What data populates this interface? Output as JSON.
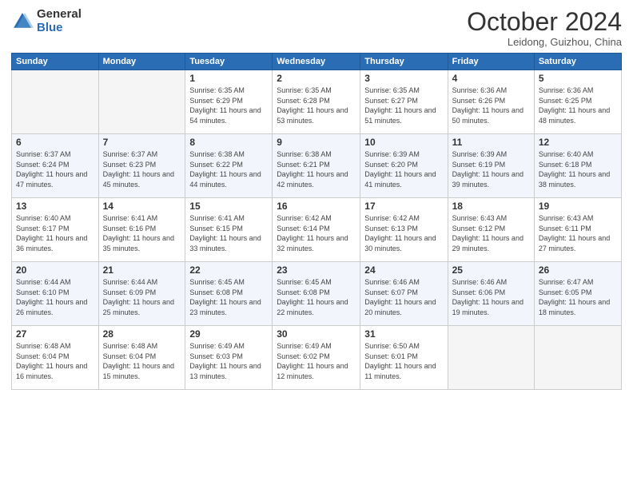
{
  "header": {
    "logo_general": "General",
    "logo_blue": "Blue",
    "month_title": "October 2024",
    "subtitle": "Leidong, Guizhou, China"
  },
  "days_of_week": [
    "Sunday",
    "Monday",
    "Tuesday",
    "Wednesday",
    "Thursday",
    "Friday",
    "Saturday"
  ],
  "weeks": [
    [
      {
        "day": "",
        "info": ""
      },
      {
        "day": "",
        "info": ""
      },
      {
        "day": "1",
        "info": "Sunrise: 6:35 AM\nSunset: 6:29 PM\nDaylight: 11 hours and 54 minutes."
      },
      {
        "day": "2",
        "info": "Sunrise: 6:35 AM\nSunset: 6:28 PM\nDaylight: 11 hours and 53 minutes."
      },
      {
        "day": "3",
        "info": "Sunrise: 6:35 AM\nSunset: 6:27 PM\nDaylight: 11 hours and 51 minutes."
      },
      {
        "day": "4",
        "info": "Sunrise: 6:36 AM\nSunset: 6:26 PM\nDaylight: 11 hours and 50 minutes."
      },
      {
        "day": "5",
        "info": "Sunrise: 6:36 AM\nSunset: 6:25 PM\nDaylight: 11 hours and 48 minutes."
      }
    ],
    [
      {
        "day": "6",
        "info": "Sunrise: 6:37 AM\nSunset: 6:24 PM\nDaylight: 11 hours and 47 minutes."
      },
      {
        "day": "7",
        "info": "Sunrise: 6:37 AM\nSunset: 6:23 PM\nDaylight: 11 hours and 45 minutes."
      },
      {
        "day": "8",
        "info": "Sunrise: 6:38 AM\nSunset: 6:22 PM\nDaylight: 11 hours and 44 minutes."
      },
      {
        "day": "9",
        "info": "Sunrise: 6:38 AM\nSunset: 6:21 PM\nDaylight: 11 hours and 42 minutes."
      },
      {
        "day": "10",
        "info": "Sunrise: 6:39 AM\nSunset: 6:20 PM\nDaylight: 11 hours and 41 minutes."
      },
      {
        "day": "11",
        "info": "Sunrise: 6:39 AM\nSunset: 6:19 PM\nDaylight: 11 hours and 39 minutes."
      },
      {
        "day": "12",
        "info": "Sunrise: 6:40 AM\nSunset: 6:18 PM\nDaylight: 11 hours and 38 minutes."
      }
    ],
    [
      {
        "day": "13",
        "info": "Sunrise: 6:40 AM\nSunset: 6:17 PM\nDaylight: 11 hours and 36 minutes."
      },
      {
        "day": "14",
        "info": "Sunrise: 6:41 AM\nSunset: 6:16 PM\nDaylight: 11 hours and 35 minutes."
      },
      {
        "day": "15",
        "info": "Sunrise: 6:41 AM\nSunset: 6:15 PM\nDaylight: 11 hours and 33 minutes."
      },
      {
        "day": "16",
        "info": "Sunrise: 6:42 AM\nSunset: 6:14 PM\nDaylight: 11 hours and 32 minutes."
      },
      {
        "day": "17",
        "info": "Sunrise: 6:42 AM\nSunset: 6:13 PM\nDaylight: 11 hours and 30 minutes."
      },
      {
        "day": "18",
        "info": "Sunrise: 6:43 AM\nSunset: 6:12 PM\nDaylight: 11 hours and 29 minutes."
      },
      {
        "day": "19",
        "info": "Sunrise: 6:43 AM\nSunset: 6:11 PM\nDaylight: 11 hours and 27 minutes."
      }
    ],
    [
      {
        "day": "20",
        "info": "Sunrise: 6:44 AM\nSunset: 6:10 PM\nDaylight: 11 hours and 26 minutes."
      },
      {
        "day": "21",
        "info": "Sunrise: 6:44 AM\nSunset: 6:09 PM\nDaylight: 11 hours and 25 minutes."
      },
      {
        "day": "22",
        "info": "Sunrise: 6:45 AM\nSunset: 6:08 PM\nDaylight: 11 hours and 23 minutes."
      },
      {
        "day": "23",
        "info": "Sunrise: 6:45 AM\nSunset: 6:08 PM\nDaylight: 11 hours and 22 minutes."
      },
      {
        "day": "24",
        "info": "Sunrise: 6:46 AM\nSunset: 6:07 PM\nDaylight: 11 hours and 20 minutes."
      },
      {
        "day": "25",
        "info": "Sunrise: 6:46 AM\nSunset: 6:06 PM\nDaylight: 11 hours and 19 minutes."
      },
      {
        "day": "26",
        "info": "Sunrise: 6:47 AM\nSunset: 6:05 PM\nDaylight: 11 hours and 18 minutes."
      }
    ],
    [
      {
        "day": "27",
        "info": "Sunrise: 6:48 AM\nSunset: 6:04 PM\nDaylight: 11 hours and 16 minutes."
      },
      {
        "day": "28",
        "info": "Sunrise: 6:48 AM\nSunset: 6:04 PM\nDaylight: 11 hours and 15 minutes."
      },
      {
        "day": "29",
        "info": "Sunrise: 6:49 AM\nSunset: 6:03 PM\nDaylight: 11 hours and 13 minutes."
      },
      {
        "day": "30",
        "info": "Sunrise: 6:49 AM\nSunset: 6:02 PM\nDaylight: 11 hours and 12 minutes."
      },
      {
        "day": "31",
        "info": "Sunrise: 6:50 AM\nSunset: 6:01 PM\nDaylight: 11 hours and 11 minutes."
      },
      {
        "day": "",
        "info": ""
      },
      {
        "day": "",
        "info": ""
      }
    ]
  ]
}
